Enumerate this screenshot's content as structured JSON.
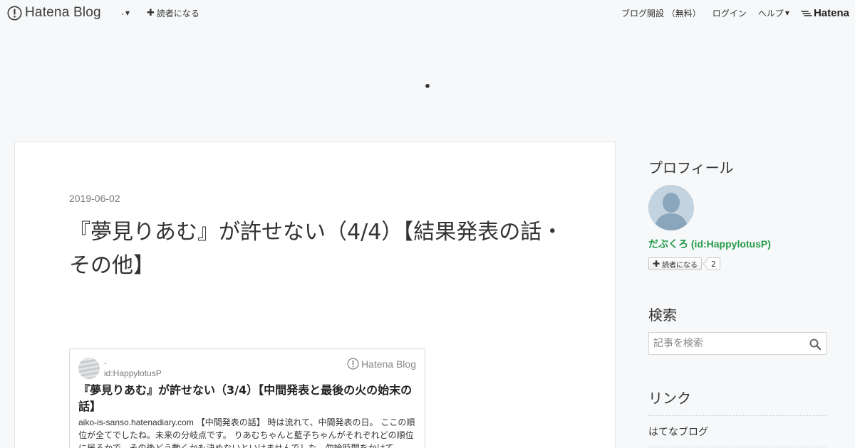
{
  "topbar": {
    "logo_text": "Hatena Blog",
    "blog_menu_label": ".",
    "subscribe_label": "読者になる",
    "nav": {
      "open_blog": "ブログ開設 （無料）",
      "login": "ログイン",
      "help": "ヘルプ",
      "brand": "Hatena"
    }
  },
  "blog": {
    "header_title": "•"
  },
  "entry": {
    "date": "2019-06-02",
    "title": "『夢見りあむ』が許せない（4/4）【結果発表の話・その他】"
  },
  "embed": {
    "blog_name": ".",
    "user_id": "id:HappylotusP",
    "logo_text": "Hatena Blog",
    "title": "『夢見りあむ』が許せない（3/4）【中間発表と最後の火の始末の話】",
    "site": "aiko-is-sanso.hatenadiary.com",
    "description": "【中間発表の話】 時は流れて、中間発表の日。 ここの順位が全てでしたね。未来の分岐点です。 りあむちゃんと藍子ちゃんがそれぞれどの順位に居るかで、その後どう動くかも決めないといけませんでした。勿論時間をかけて"
  },
  "sidebar": {
    "profile": {
      "heading": "プロフィール",
      "name": "だぶくろ (id:HappylotusP)",
      "subscribe_label": "読者になる",
      "subscriber_count": "2"
    },
    "search": {
      "heading": "検索",
      "placeholder": "記事を検索"
    },
    "links": {
      "heading": "リンク",
      "items": [
        "はてなブログ"
      ]
    }
  },
  "colors": {
    "background": "#f7f8f9",
    "profile_name": "#239b4a",
    "embed_link": "#1a5dab"
  }
}
